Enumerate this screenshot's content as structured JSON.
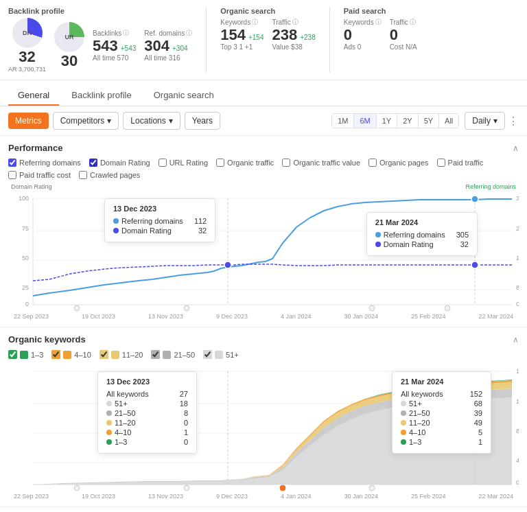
{
  "header": {
    "backlink_profile": {
      "title": "Backlink profile",
      "dr_label": "DR",
      "dr_value": "32",
      "ar_label": "AR",
      "ar_value": "3,700,731",
      "ur_label": "UR",
      "ur_value": "30",
      "backlinks_label": "Backlinks",
      "backlinks_value": "543",
      "backlinks_change": "+543",
      "backlinks_alltime": "All time 570",
      "refdomains_label": "Ref. domains",
      "refdomains_value": "304",
      "refdomains_change": "+304",
      "refdomains_alltime": "All time 316"
    },
    "organic_search": {
      "title": "Organic search",
      "keywords_label": "Keywords",
      "keywords_value": "154",
      "keywords_change": "+154",
      "keywords_sub": "Top 3  1  +1",
      "traffic_label": "Traffic",
      "traffic_value": "238",
      "traffic_change": "+238",
      "traffic_sub": "Value $38"
    },
    "paid_search": {
      "title": "Paid search",
      "keywords_label": "Keywords",
      "keywords_value": "0",
      "keywords_sub": "Ads  0",
      "traffic_label": "Traffic",
      "traffic_value": "0",
      "traffic_sub": "Cost  N/A"
    }
  },
  "tabs": {
    "items": [
      {
        "label": "General",
        "active": true
      },
      {
        "label": "Backlink profile",
        "active": false
      },
      {
        "label": "Organic search",
        "active": false
      }
    ]
  },
  "toolbar": {
    "metrics_label": "Metrics",
    "competitors_label": "Competitors",
    "locations_label": "Locations",
    "years_label": "Years",
    "time_buttons": [
      "1M",
      "6M",
      "1Y",
      "2Y",
      "5Y",
      "All"
    ],
    "active_time": "6M",
    "interval_label": "Daily"
  },
  "performance": {
    "title": "Performance",
    "checkboxes": [
      {
        "label": "Referring domains",
        "checked": true,
        "color": "blue"
      },
      {
        "label": "Domain Rating",
        "checked": true,
        "color": "indigo"
      },
      {
        "label": "URL Rating",
        "checked": false,
        "color": "gray"
      },
      {
        "label": "Organic traffic",
        "checked": false,
        "color": "gray"
      },
      {
        "label": "Organic traffic value",
        "checked": false,
        "color": "gray"
      },
      {
        "label": "Organic pages",
        "checked": false,
        "color": "gray"
      },
      {
        "label": "Paid traffic",
        "checked": false,
        "color": "gray"
      },
      {
        "label": "Paid traffic cost",
        "checked": false,
        "color": "gray"
      },
      {
        "label": "Crawled pages",
        "checked": false,
        "color": "gray"
      }
    ],
    "axis_left": "Domain Rating",
    "axis_right": "Referring domains",
    "tooltip1": {
      "date": "13 Dec 2023",
      "rows": [
        {
          "label": "Referring domains",
          "value": "112",
          "dot": "blue"
        },
        {
          "label": "Domain Rating",
          "value": "32",
          "dot": "indigo"
        }
      ]
    },
    "tooltip2": {
      "date": "21 Mar 2024",
      "rows": [
        {
          "label": "Referring domains",
          "value": "305",
          "dot": "blue"
        },
        {
          "label": "Domain Rating",
          "value": "32",
          "dot": "indigo"
        }
      ]
    },
    "x_labels": [
      "22 Sep 2023",
      "19 Oct 2023",
      "13 Nov 2023",
      "9 Dec 2023",
      "4 Jan 2024",
      "30 Jan 2024",
      "25 Feb 2024",
      "22 Mar 2024"
    ]
  },
  "organic_keywords": {
    "title": "Organic keywords",
    "legend": [
      {
        "label": "1–3",
        "color": "#2c9e56",
        "checked": true
      },
      {
        "label": "4–10",
        "color": "#f0a030",
        "checked": true
      },
      {
        "label": "11–20",
        "color": "#e8c870",
        "checked": true
      },
      {
        "label": "21–50",
        "color": "#b0b0b0",
        "checked": true
      },
      {
        "label": "51+",
        "color": "#d8d8d8",
        "checked": true
      }
    ],
    "tooltip1": {
      "date": "13 Dec 2023",
      "rows": [
        {
          "label": "All keywords",
          "value": "27"
        },
        {
          "label": "51+",
          "value": "18",
          "dot": "lt-gray"
        },
        {
          "label": "21–50",
          "value": "8",
          "dot": "gray"
        },
        {
          "label": "11–20",
          "value": "0",
          "dot": "gold"
        },
        {
          "label": "4–10",
          "value": "1",
          "dot": "orange"
        },
        {
          "label": "1–3",
          "value": "0",
          "dot": "green"
        }
      ]
    },
    "tooltip2": {
      "date": "21 Mar 2024",
      "rows": [
        {
          "label": "All keywords",
          "value": "152"
        },
        {
          "label": "51+",
          "value": "68",
          "dot": "lt-gray"
        },
        {
          "label": "21–50",
          "value": "39",
          "dot": "gray"
        },
        {
          "label": "11–20",
          "value": "49",
          "dot": "gold"
        },
        {
          "label": "4–10",
          "value": "5",
          "dot": "orange"
        },
        {
          "label": "1–3",
          "value": "1",
          "dot": "green"
        }
      ]
    },
    "x_labels": [
      "22 Sep 2023",
      "19 Oct 2023",
      "13 Nov 2023",
      "9 Dec 2023",
      "4 Jan 2024",
      "30 Jan 2024",
      "25 Feb 2024",
      "22 Mar 2024"
    ]
  }
}
